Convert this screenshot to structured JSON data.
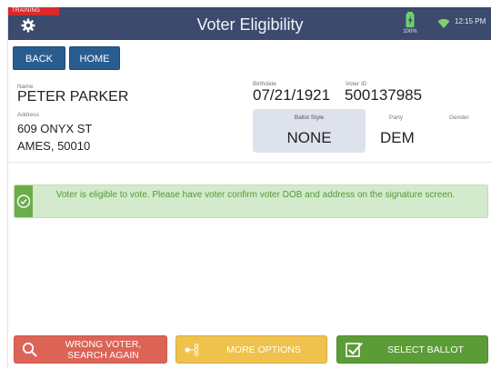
{
  "header": {
    "training_badge": "TRAINING",
    "title": "Voter Eligibility",
    "battery_pct": "100%",
    "time": "12:15 PM"
  },
  "nav": {
    "back_label": "BACK",
    "home_label": "HOME"
  },
  "voter": {
    "name_label": "Name",
    "name": "PETER PARKER",
    "birthdate_label": "Birthdate",
    "birthdate": "07/21/1921",
    "voter_id_label": "Voter ID",
    "voter_id": "500137985",
    "address_label": "Address",
    "address_line1": "609 ONYX ST",
    "address_line2": "AMES, 50010",
    "ballot_style_label": "Ballot Style",
    "ballot_style": "NONE",
    "party_label": "Party",
    "party": "DEM",
    "gender_label": "Gender",
    "gender": ""
  },
  "message": {
    "text": "Voter is eligible to vote. Please have voter confirm voter DOB and address on the signature screen."
  },
  "actions": {
    "wrong_voter_line1": "WRONG VOTER,",
    "wrong_voter_line2": "SEARCH AGAIN",
    "more_options": "MORE OPTIONS",
    "select_ballot": "SELECT BALLOT"
  },
  "colors": {
    "header_bg": "#3c4a6d",
    "training_red": "#d52b2b",
    "nav_blue": "#2a5d8f",
    "eligible_green": "#6aad4b",
    "wrong_red": "#dc6457",
    "more_yellow": "#eec24c",
    "select_green": "#5c9c37"
  },
  "icons": {
    "settings": "gear-icon",
    "battery": "battery-icon",
    "wifi": "wifi-icon",
    "eligible": "check-circle-icon",
    "search": "magnifier-icon",
    "options": "options-icon",
    "ballot": "checkbox-icon"
  }
}
